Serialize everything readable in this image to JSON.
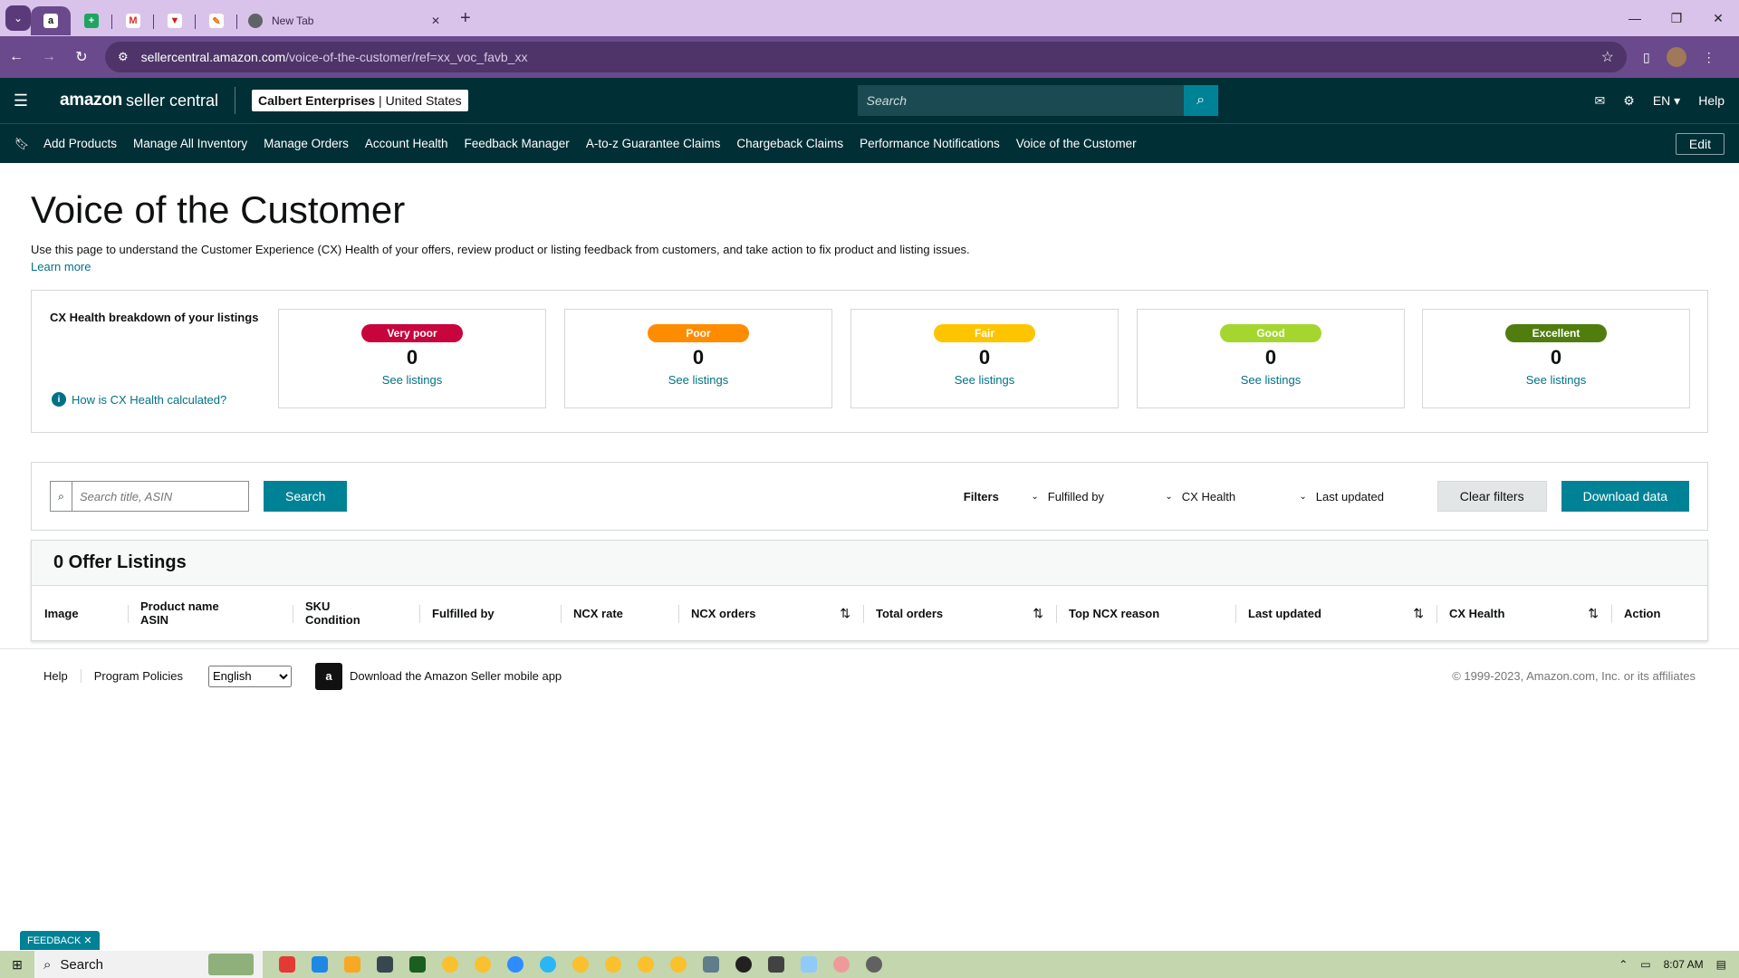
{
  "browser": {
    "tabs": [
      {
        "name": "amazon-tab",
        "label": "a"
      },
      {
        "name": "sheets-tab",
        "label": "+"
      },
      {
        "name": "gmail-tab",
        "label": "M"
      },
      {
        "name": "tab-4",
        "label": "▼"
      },
      {
        "name": "tab-5",
        "label": "✎"
      }
    ],
    "new_tab_label": "New Tab",
    "url_host": "sellercentral.amazon.com",
    "url_path": "/voice-of-the-customer/ref=xx_voc_favb_xx"
  },
  "header": {
    "logo_brand": "amazon",
    "logo_product": "seller central",
    "account_name": "Calbert Enterprises",
    "account_region": "United States",
    "search_placeholder": "Search",
    "language": "EN",
    "help": "Help"
  },
  "nav": {
    "links": [
      "Add Products",
      "Manage All Inventory",
      "Manage Orders",
      "Account Health",
      "Feedback Manager",
      "A-to-z Guarantee Claims",
      "Chargeback Claims",
      "Performance Notifications",
      "Voice of the Customer"
    ],
    "edit": "Edit"
  },
  "page": {
    "title": "Voice of the Customer",
    "description": "Use this page to understand the Customer Experience (CX) Health of your offers, review product or listing feedback from customers, and take action to fix product and listing issues.",
    "learn_more": "Learn more"
  },
  "cx": {
    "title": "CX Health breakdown of your listings",
    "how_link": "How is CX Health calculated?",
    "cards": [
      {
        "label": "Very poor",
        "count": "0",
        "link": "See listings",
        "color": "#c7043c",
        "text": "#ffffff"
      },
      {
        "label": "Poor",
        "count": "0",
        "link": "See listings",
        "color": "#ff8c00",
        "text": "#ffffff"
      },
      {
        "label": "Fair",
        "count": "0",
        "link": "See listings",
        "color": "#ffc400",
        "text": "#ffffff"
      },
      {
        "label": "Good",
        "count": "0",
        "link": "See listings",
        "color": "#a5d62f",
        "text": "#ffffff"
      },
      {
        "label": "Excellent",
        "count": "0",
        "link": "See listings",
        "color": "#517d0f",
        "text": "#ffffff"
      }
    ]
  },
  "filters": {
    "search_placeholder": "Search title, ASIN",
    "search_button": "Search",
    "label": "Filters",
    "dropdowns": [
      "Fulfilled by",
      "CX Health",
      "Last updated"
    ],
    "clear": "Clear filters",
    "download": "Download data"
  },
  "listings": {
    "heading": "0 Offer Listings",
    "columns": [
      {
        "l1": "Image",
        "l2": "",
        "sortable": false
      },
      {
        "l1": "Product name",
        "l2": "ASIN",
        "sortable": false
      },
      {
        "l1": "SKU",
        "l2": "Condition",
        "sortable": false
      },
      {
        "l1": "Fulfilled by",
        "l2": "",
        "sortable": false
      },
      {
        "l1": "NCX rate",
        "l2": "",
        "sortable": false
      },
      {
        "l1": "NCX orders",
        "l2": "",
        "sortable": true
      },
      {
        "l1": "Total orders",
        "l2": "",
        "sortable": true
      },
      {
        "l1": "Top NCX reason",
        "l2": "",
        "sortable": false
      },
      {
        "l1": "Last updated",
        "l2": "",
        "sortable": true
      },
      {
        "l1": "CX Health",
        "l2": "",
        "sortable": true
      },
      {
        "l1": "Action",
        "l2": "",
        "sortable": false
      }
    ]
  },
  "footer": {
    "help": "Help",
    "policies": "Program Policies",
    "language": "English",
    "app": "Download the Amazon Seller mobile app",
    "copyright": "© 1999-2023, Amazon.com, Inc. or its affiliates"
  },
  "feedback": "FEEDBACK",
  "taskbar": {
    "search": "Search",
    "time": "8:07 AM"
  }
}
